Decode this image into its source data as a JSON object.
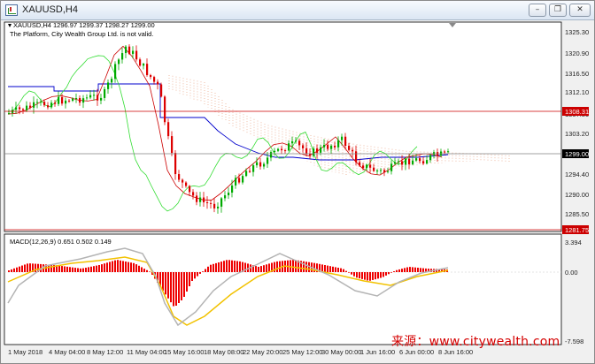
{
  "window": {
    "title": "XAUUSD,H4",
    "buttons": {
      "minimize": "–",
      "restore": "❐",
      "close": "✕"
    }
  },
  "chart": {
    "info_line": "XAUUSD,H4  1296.97 1299.37 1298.27 1299.00",
    "notice": "The Platform, City Wealth Group Ltd. is not valid.",
    "price_ticks": [
      "1325.30",
      "1320.90",
      "1316.50",
      "1312.10",
      "1307.80",
      "1303.20",
      "1294.40",
      "1290.00",
      "1285.50",
      "1281.20"
    ],
    "current_price_label": "1299.00",
    "upper_level_label": "1308.31",
    "lower_level_label": "1281.75",
    "date_ticks": [
      "1 May 2018",
      "4 May 04:00",
      "8 May 12:00",
      "11 May 04:00",
      "15 May 16:00",
      "18 May 08:00",
      "22 May 20:00",
      "25 May 12:00",
      "30 May 00:00",
      "1 Jun 16:00",
      "6 Jun 00:00",
      "8 Jun 16:00"
    ],
    "colors": {
      "bull": "#00aa00",
      "bear": "#dd0000",
      "kijun": "#0000cc",
      "tenkan": "#cc0000",
      "chikou": "#33dd33",
      "cloud": "#e8a080",
      "level_line": "#cc0000",
      "price_line": "#808080"
    }
  },
  "macd": {
    "label": "MACD(12,26,9) 0.651 0.502 0.149",
    "ticks": [
      "3.394",
      "0.00",
      "-7.598"
    ],
    "colors": {
      "hist": "#ee0000",
      "signal": "#f2c200",
      "macd_line": "#b4b4b4"
    }
  },
  "watermark": "来源：www.citywealth.com"
}
